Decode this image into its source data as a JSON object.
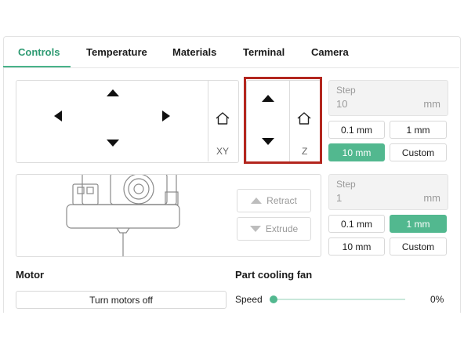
{
  "tabs": [
    {
      "label": "Controls",
      "active": true
    },
    {
      "label": "Temperature"
    },
    {
      "label": "Materials"
    },
    {
      "label": "Terminal"
    },
    {
      "label": "Camera"
    }
  ],
  "xy_pad": {
    "axis_label": "XY"
  },
  "z_pad": {
    "axis_label": "Z"
  },
  "jog_step": {
    "label": "Step",
    "value": "10",
    "unit": "mm",
    "options": [
      "0.1 mm",
      "1 mm",
      "10 mm",
      "Custom"
    ],
    "selected": "10 mm"
  },
  "extrude_step": {
    "label": "Step",
    "value": "1",
    "unit": "mm",
    "options": [
      "0.1 mm",
      "1 mm",
      "10 mm",
      "Custom"
    ],
    "selected": "1 mm"
  },
  "extruder": {
    "retract_label": "Retract",
    "extrude_label": "Extrude"
  },
  "motor": {
    "title": "Motor",
    "button_label": "Turn motors off"
  },
  "fan": {
    "title": "Part cooling fan",
    "speed_label": "Speed",
    "speed_value": "0%",
    "speed_fraction": 0
  },
  "colors": {
    "accent": "#52b88f",
    "highlight": "#b3261e"
  }
}
